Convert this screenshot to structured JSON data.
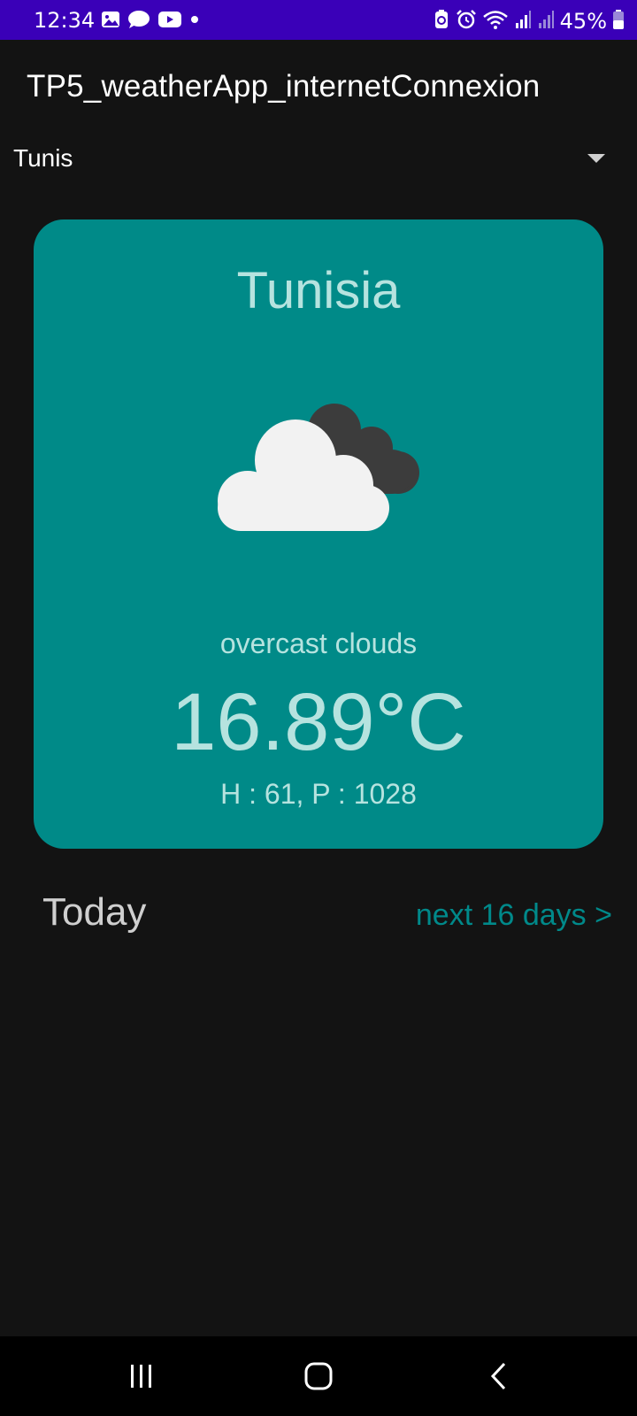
{
  "status_bar": {
    "time": "12:34",
    "battery": "45%",
    "left_icons": [
      "gallery-icon",
      "chat-icon",
      "youtube-icon",
      "dot-icon"
    ],
    "right_icons": [
      "battery-saver-icon",
      "alarm-icon",
      "wifi-icon",
      "signal-icon",
      "signal-icon",
      "battery-icon"
    ],
    "background": "#3a00b8"
  },
  "app_bar": {
    "title": "TP5_weatherApp_internetConnexion"
  },
  "city_select": {
    "selected": "Tunis",
    "arrow_icon": "dropdown-arrow-icon"
  },
  "weather_card": {
    "country": "Tunisia",
    "icon": "overcast-clouds-icon",
    "description": "overcast clouds",
    "temperature": "16.89°C",
    "details": "H : 61, P : 1028",
    "background": "#008a88"
  },
  "section": {
    "today_label": "Today",
    "next_link": "next 16 days >"
  },
  "nav_bar": {
    "buttons": [
      "recent-apps-icon",
      "home-icon",
      "back-icon"
    ]
  }
}
